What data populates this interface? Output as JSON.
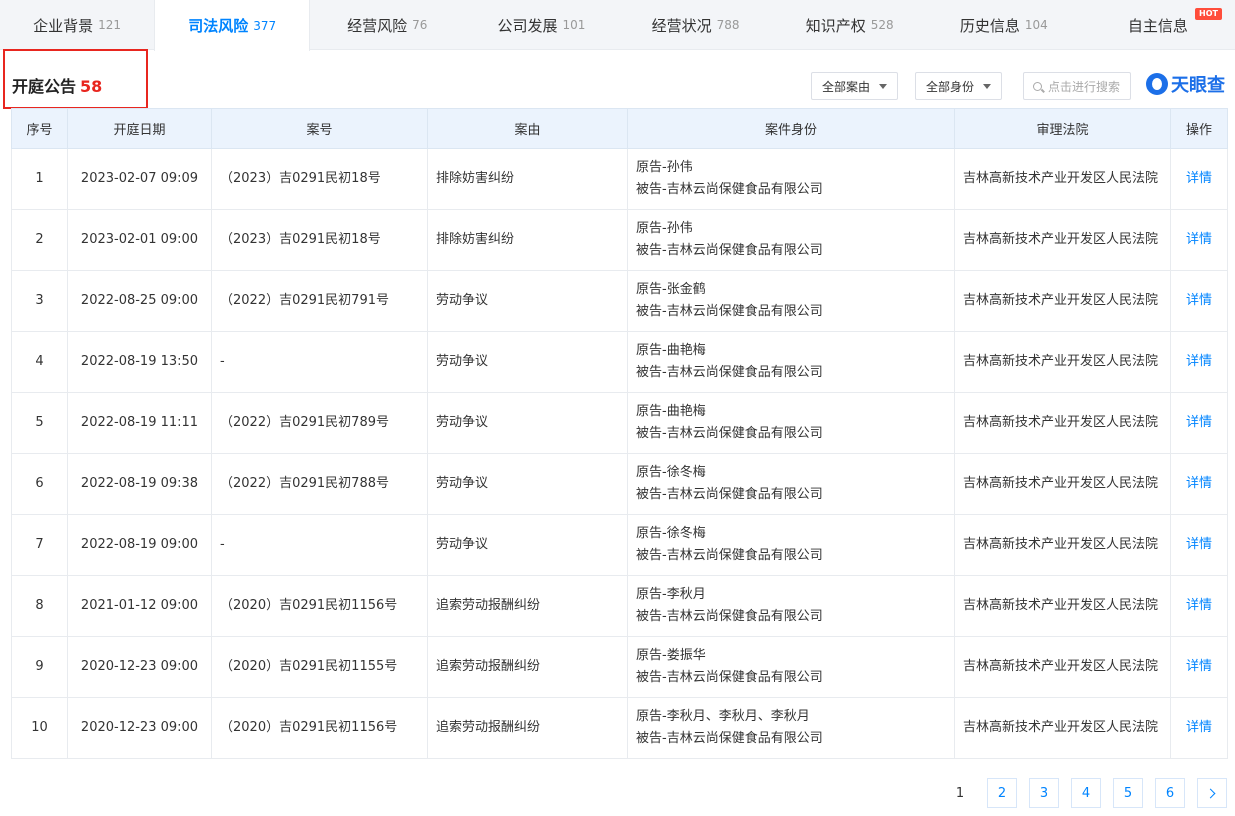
{
  "tabs": [
    {
      "label": "企业背景",
      "count": "121"
    },
    {
      "label": "司法风险",
      "count": "377"
    },
    {
      "label": "经营风险",
      "count": "76"
    },
    {
      "label": "公司发展",
      "count": "101"
    },
    {
      "label": "经营状况",
      "count": "788"
    },
    {
      "label": "知识产权",
      "count": "528"
    },
    {
      "label": "历史信息",
      "count": "104"
    },
    {
      "label": "自主信息",
      "count": "",
      "badge": "HOT"
    }
  ],
  "active_tab": "司法风险",
  "section": {
    "title": "开庭公告",
    "count": "58"
  },
  "filters": {
    "reason": "全部案由",
    "identity": "全部身份"
  },
  "search": {
    "placeholder": "点击进行搜索"
  },
  "logo": {
    "text": "天眼查"
  },
  "table": {
    "headers": [
      "序号",
      "开庭日期",
      "案号",
      "案由",
      "案件身份",
      "审理法院",
      "操作"
    ],
    "rows": [
      {
        "no": "1",
        "date": "2023-02-07 09:09",
        "case_no": "（2023）吉0291民初18号",
        "reason": "排除妨害纠纷",
        "plaintiff": "原告-孙伟",
        "defendant": "被告-吉林云尚保健食品有限公司",
        "court": "吉林高新技术产业开发区人民法院",
        "action": "详情"
      },
      {
        "no": "2",
        "date": "2023-02-01 09:00",
        "case_no": "（2023）吉0291民初18号",
        "reason": "排除妨害纠纷",
        "plaintiff": "原告-孙伟",
        "defendant": "被告-吉林云尚保健食品有限公司",
        "court": "吉林高新技术产业开发区人民法院",
        "action": "详情"
      },
      {
        "no": "3",
        "date": "2022-08-25 09:00",
        "case_no": "（2022）吉0291民初791号",
        "reason": "劳动争议",
        "plaintiff": "原告-张金鹤",
        "defendant": "被告-吉林云尚保健食品有限公司",
        "court": "吉林高新技术产业开发区人民法院",
        "action": "详情"
      },
      {
        "no": "4",
        "date": "2022-08-19 13:50",
        "case_no": "-",
        "reason": "劳动争议",
        "plaintiff": "原告-曲艳梅",
        "defendant": "被告-吉林云尚保健食品有限公司",
        "court": "吉林高新技术产业开发区人民法院",
        "action": "详情"
      },
      {
        "no": "5",
        "date": "2022-08-19 11:11",
        "case_no": "（2022）吉0291民初789号",
        "reason": "劳动争议",
        "plaintiff": "原告-曲艳梅",
        "defendant": "被告-吉林云尚保健食品有限公司",
        "court": "吉林高新技术产业开发区人民法院",
        "action": "详情"
      },
      {
        "no": "6",
        "date": "2022-08-19 09:38",
        "case_no": "（2022）吉0291民初788号",
        "reason": "劳动争议",
        "plaintiff": "原告-徐冬梅",
        "defendant": "被告-吉林云尚保健食品有限公司",
        "court": "吉林高新技术产业开发区人民法院",
        "action": "详情"
      },
      {
        "no": "7",
        "date": "2022-08-19 09:00",
        "case_no": "-",
        "reason": "劳动争议",
        "plaintiff": "原告-徐冬梅",
        "defendant": "被告-吉林云尚保健食品有限公司",
        "court": "吉林高新技术产业开发区人民法院",
        "action": "详情"
      },
      {
        "no": "8",
        "date": "2021-01-12 09:00",
        "case_no": "（2020）吉0291民初1156号",
        "reason": "追索劳动报酬纠纷",
        "plaintiff": "原告-李秋月",
        "defendant": "被告-吉林云尚保健食品有限公司",
        "court": "吉林高新技术产业开发区人民法院",
        "action": "详情"
      },
      {
        "no": "9",
        "date": "2020-12-23 09:00",
        "case_no": "（2020）吉0291民初1155号",
        "reason": "追索劳动报酬纠纷",
        "plaintiff": "原告-娄振华",
        "defendant": "被告-吉林云尚保健食品有限公司",
        "court": "吉林高新技术产业开发区人民法院",
        "action": "详情"
      },
      {
        "no": "10",
        "date": "2020-12-23 09:00",
        "case_no": "（2020）吉0291民初1156号",
        "reason": "追索劳动报酬纠纷",
        "plaintiff": "原告-李秋月、李秋月、李秋月",
        "defendant": "被告-吉林云尚保健食品有限公司",
        "court": "吉林高新技术产业开发区人民法院",
        "action": "详情"
      }
    ]
  },
  "pagination": {
    "pages": [
      "1",
      "2",
      "3",
      "4",
      "5",
      "6"
    ],
    "current": "1"
  },
  "colors": {
    "accent": "#0084ff",
    "highlight": "#e8261f",
    "header_bg": "#ebf3fd",
    "tab_bg": "#f3f5f8"
  }
}
